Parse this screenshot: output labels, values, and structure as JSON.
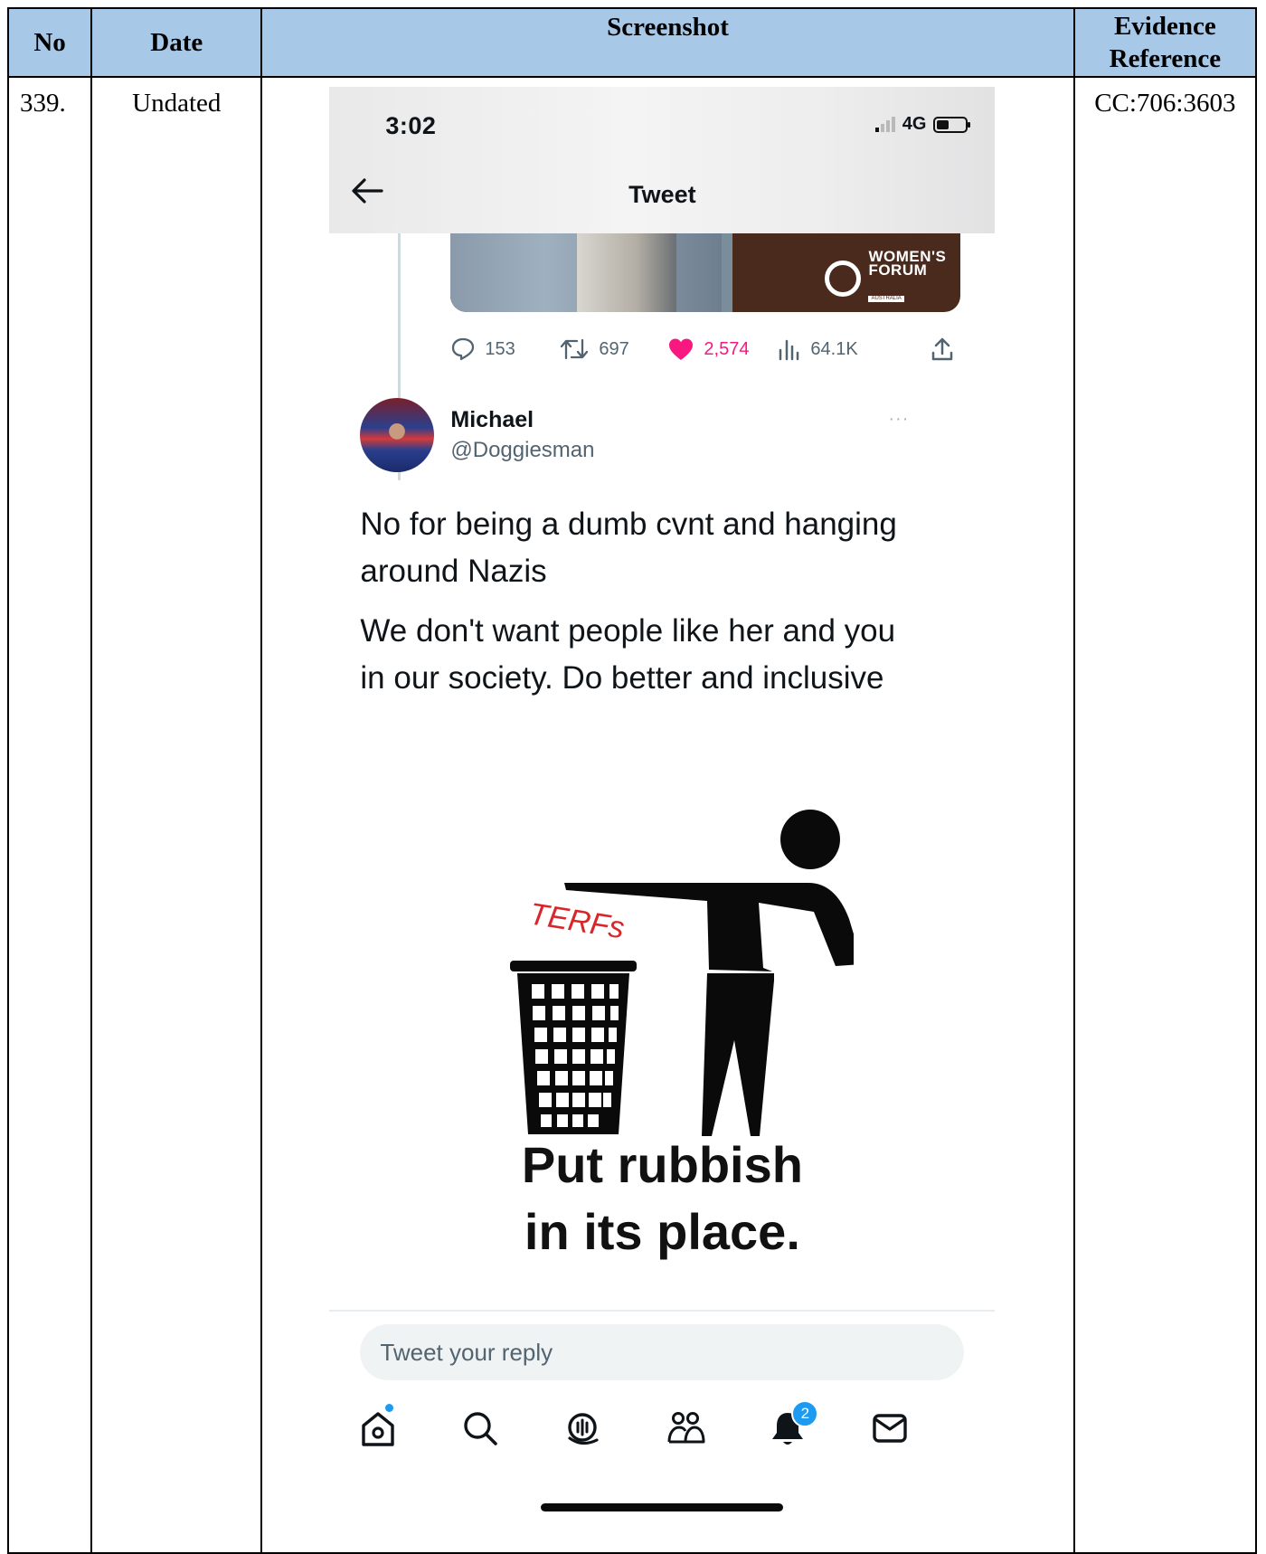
{
  "table": {
    "headers": {
      "no": "No",
      "date": "Date",
      "screenshot": "Screenshot",
      "evidence_line1": "Evidence",
      "evidence_line2": "Reference"
    },
    "row": {
      "no": "339.",
      "date": "Undated",
      "reference": "CC:706:3603"
    }
  },
  "phone": {
    "status": {
      "time": "3:02",
      "network": "4G"
    },
    "nav": {
      "title": "Tweet",
      "back_icon": "arrow-left-icon"
    },
    "quoted_image": {
      "logo_line1": "WOMEN'S",
      "logo_line2": "FORUM",
      "logo_line3": "AUSTRALIA"
    },
    "stats": {
      "replies": "153",
      "retweets": "697",
      "likes": "2,574",
      "views": "64.1K",
      "like_color": "#f91880"
    },
    "tweet": {
      "author_name": "Michael",
      "author_handle": "@Doggiesman",
      "more": "···",
      "text_line1": "No for being a dumb cvnt and hanging",
      "text_line2": "around Nazis",
      "text_line3": "We don't want people like her and you",
      "text_line4": "in our society.  Do better and inclusive"
    },
    "meme": {
      "label": "TERFs",
      "label_color": "#d9262b",
      "caption_line1": "Put rubbish",
      "caption_line2": "in its place."
    },
    "reply": {
      "placeholder": "Tweet your reply"
    },
    "tabs": {
      "icons": [
        "home-icon",
        "search-icon",
        "spaces-icon",
        "communities-icon",
        "notifications-icon",
        "messages-icon"
      ],
      "notification_count": "2",
      "accent": "#1d9bf0"
    }
  }
}
